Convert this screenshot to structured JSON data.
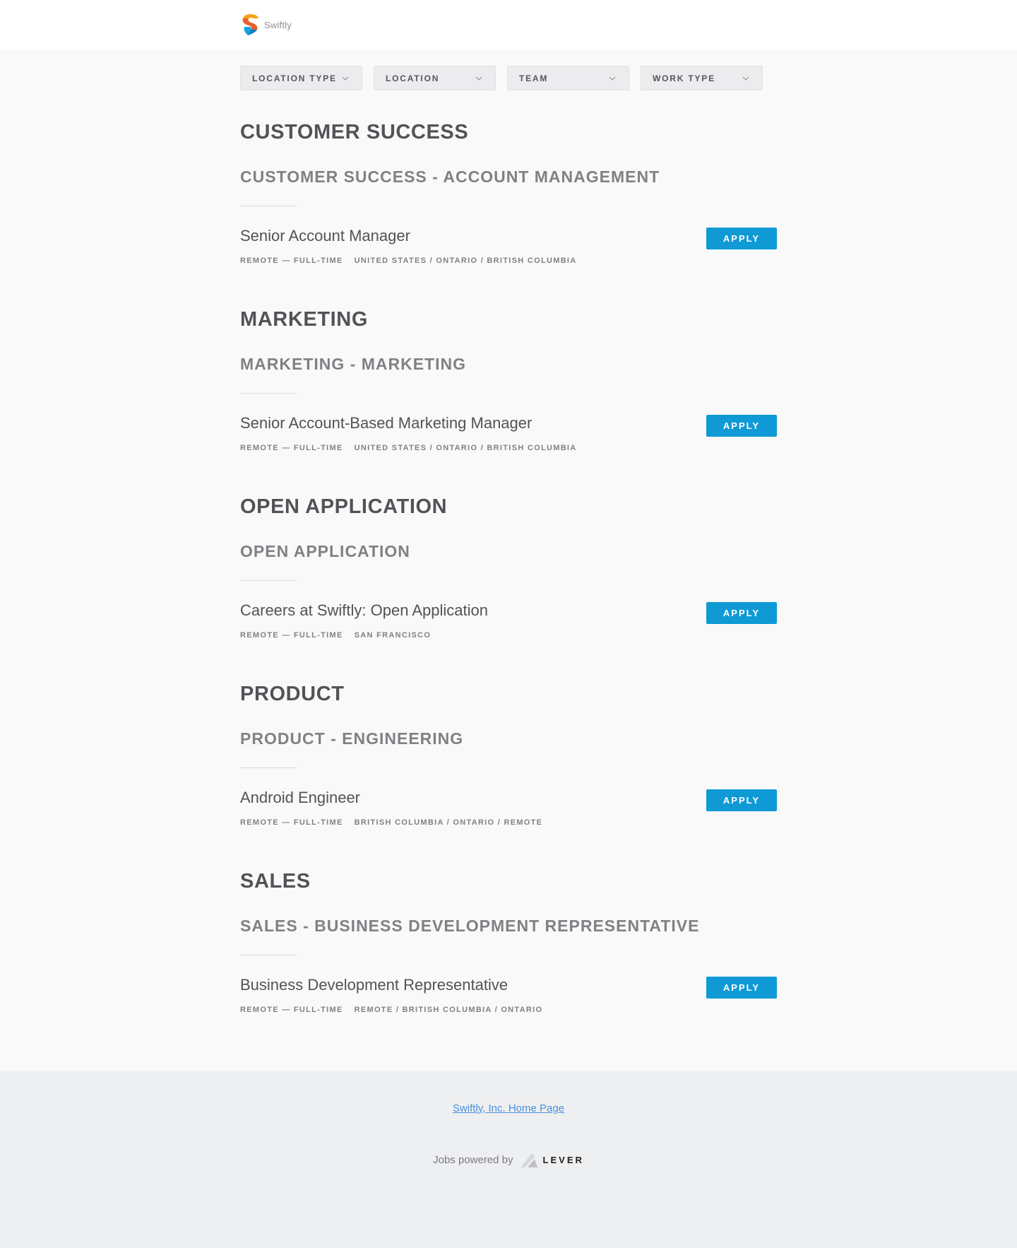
{
  "header": {
    "brand": "Swiftly",
    "logo_icon": "swiftly-logo-icon"
  },
  "filters": [
    {
      "label": "LOCATION TYPE"
    },
    {
      "label": "LOCATION"
    },
    {
      "label": "TEAM"
    },
    {
      "label": "WORK TYPE"
    }
  ],
  "groups": [
    {
      "title": "CUSTOMER SUCCESS",
      "subtitle": "CUSTOMER SUCCESS - ACCOUNT MANAGEMENT",
      "posting": {
        "title": "Senior Account Manager",
        "commitment": "REMOTE — FULL-TIME",
        "location": "UNITED STATES / ONTARIO / BRITISH COLUMBIA",
        "apply": "APPLY"
      }
    },
    {
      "title": "MARKETING",
      "subtitle": "MARKETING - MARKETING",
      "posting": {
        "title": "Senior Account-Based Marketing Manager",
        "commitment": "REMOTE — FULL-TIME",
        "location": "UNITED STATES / ONTARIO / BRITISH COLUMBIA",
        "apply": "APPLY"
      }
    },
    {
      "title": "OPEN APPLICATION",
      "subtitle": "OPEN APPLICATION",
      "posting": {
        "title": "Careers at Swiftly: Open Application",
        "commitment": "REMOTE — FULL-TIME",
        "location": "SAN FRANCISCO",
        "apply": "APPLY"
      }
    },
    {
      "title": "PRODUCT",
      "subtitle": "PRODUCT - ENGINEERING",
      "posting": {
        "title": "Android Engineer",
        "commitment": "REMOTE — FULL-TIME",
        "location": "BRITISH COLUMBIA / ONTARIO / REMOTE",
        "apply": "APPLY"
      }
    },
    {
      "title": "SALES",
      "subtitle": "SALES - BUSINESS DEVELOPMENT REPRESENTATIVE",
      "posting": {
        "title": "Business Development Representative",
        "commitment": "REMOTE — FULL-TIME",
        "location": "REMOTE / BRITISH COLUMBIA / ONTARIO",
        "apply": "APPLY"
      }
    }
  ],
  "footer": {
    "home_link": "Swiftly, Inc. Home Page",
    "powered_by": "Jobs powered by",
    "lever": "LEVER"
  },
  "colors": {
    "accent": "#0f9ad6",
    "link": "#4a90d9",
    "page_bg": "#f9f9f9",
    "footer_bg": "#eeeff1"
  }
}
